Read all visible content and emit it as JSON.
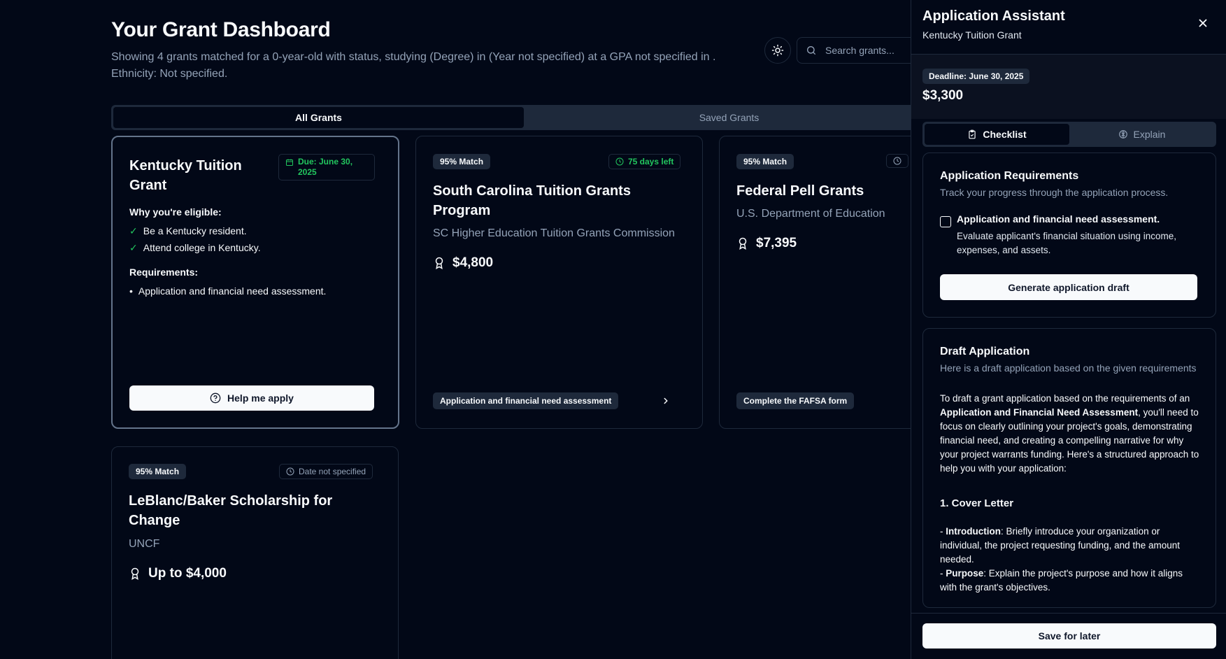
{
  "header": {
    "title": "Your Grant Dashboard",
    "subtitle_line1": "Showing 4 grants matched for a 0-year-old with status, studying (Degree) in (Year not specified) at a GPA not specified in .",
    "subtitle_line2": "Ethnicity: Not specified.",
    "search_placeholder": "Search grants..."
  },
  "tabs": {
    "all": "All Grants",
    "saved": "Saved Grants"
  },
  "cards": {
    "kentucky": {
      "title": "Kentucky Tuition Grant",
      "due": "Due: June 30, 2025",
      "eligible_heading": "Why you're eligible:",
      "eligible": [
        "Be a Kentucky resident.",
        "Attend college in Kentucky."
      ],
      "requirements_heading": "Requirements:",
      "requirements": [
        "Application and financial need assessment."
      ],
      "help_label": "Help me apply"
    },
    "south_carolina": {
      "match": "95% Match",
      "days": "75 days left",
      "title": "South Carolina Tuition Grants Program",
      "org": "SC Higher Education Tuition Grants Commission",
      "amount": "$4,800",
      "pill": "Application and financial need assessment"
    },
    "pell": {
      "match": "95% Match",
      "title": "Federal Pell Grants",
      "org": "U.S. Department of Education",
      "amount": "$7,395",
      "pill": "Complete the FAFSA form"
    },
    "leblanc": {
      "match": "95% Match",
      "date": "Date not specified",
      "title": "LeBlanc/Baker Scholarship for Change",
      "org": "UNCF",
      "amount": "Up to $4,000"
    }
  },
  "panel": {
    "title": "Application Assistant",
    "subtitle": "Kentucky Tuition Grant",
    "deadline": "Deadline: June 30, 2025",
    "amount": "$3,300",
    "tab_checklist": "Checklist",
    "tab_explain": "Explain",
    "requirements": {
      "heading": "Application Requirements",
      "sub": "Track your progress through the application process.",
      "item_title": "Application and financial need assessment.",
      "item_desc": "Evaluate applicant's financial situation using income, expenses, and assets.",
      "generate_label": "Generate application draft"
    },
    "draft": {
      "heading": "Draft Application",
      "sub": "Here is a draft application based on the given requirements",
      "intro_a": "To draft a grant application based on the requirements of an ",
      "intro_bold": "Application and Financial Need Assessment",
      "intro_b": ", you'll need to focus on clearly outlining your project's goals, demonstrating financial need, and creating a compelling narrative for why your project warrants funding. Here's a structured approach to help you with your application:",
      "section1": "1. Cover Letter",
      "b1_label": "Introduction",
      "b1_text": ": Briefly introduce your organization or individual, the project requesting funding, and the amount needed.",
      "b2_label": "Purpose",
      "b2_text": ": Explain the project's purpose and how it aligns with the grant's objectives."
    },
    "save_label": "Save for later"
  },
  "colors": {
    "background": "#020817",
    "accent_green": "#22c55e",
    "muted": "#94a3b8",
    "border": "#1e293b"
  }
}
